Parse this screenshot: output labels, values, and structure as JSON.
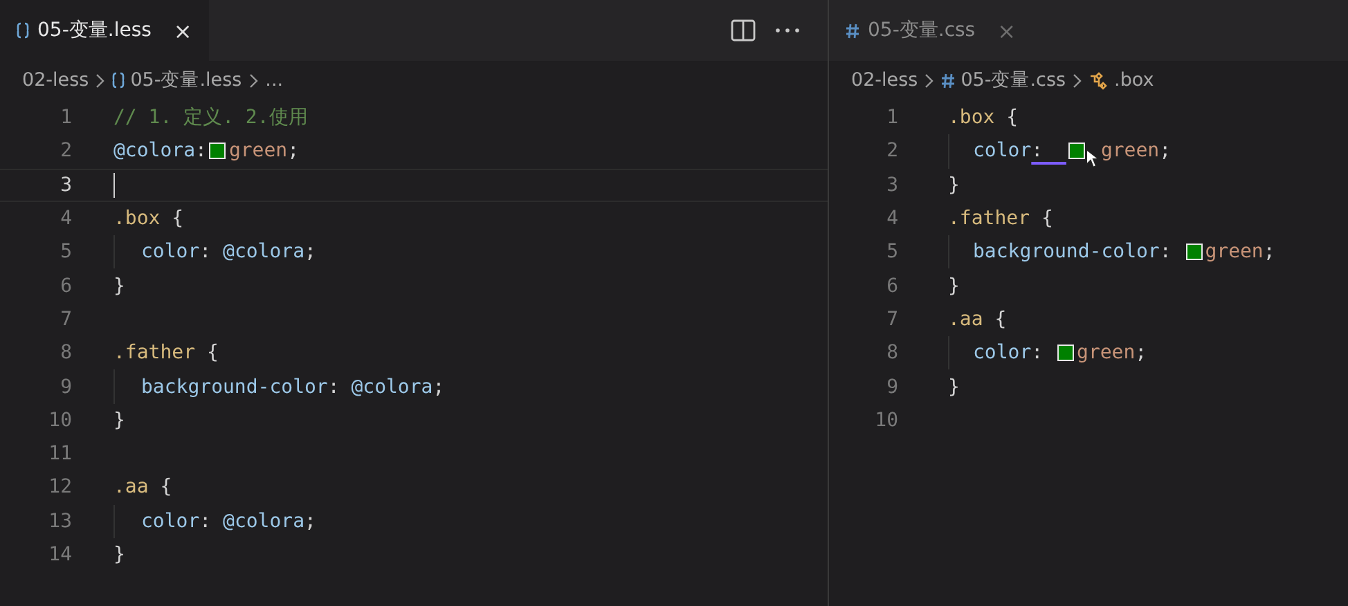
{
  "panes": [
    {
      "kind": "less",
      "tab": {
        "label": "05-变量.less",
        "selected": true,
        "close": "×"
      },
      "actions": [
        {
          "kind": "split"
        },
        {
          "kind": "more"
        }
      ],
      "breadcrumbs": [
        {
          "kind": "folder",
          "text": "02-less"
        },
        {
          "kind": "file",
          "text": "05-变量.less"
        },
        {
          "kind": "folder",
          "text": "..."
        }
      ],
      "lines": [
        {
          "number": "1",
          "current": false,
          "tokens": [
            {
              "kind": "comment",
              "text": "// 1. 定义. 2.使用"
            }
          ]
        },
        {
          "number": "2",
          "current": false,
          "tokens": [
            {
              "kind": "variable",
              "text": "@colora"
            },
            {
              "kind": "punct",
              "text": ":"
            },
            {
              "kind": "swatch",
              "color": "#008000"
            },
            {
              "kind": "value",
              "text": "green"
            },
            {
              "kind": "punct",
              "text": ";"
            }
          ]
        },
        {
          "number": "3",
          "current": true
        },
        {
          "number": "4",
          "current": false,
          "tokens": [
            {
              "kind": "selector",
              "text": ".box"
            },
            {
              "kind": "punct",
              "text": " {"
            }
          ],
          "children": [
            {
              "number": "5",
              "current": false,
              "tokens": [
                {
                  "kind": "property",
                  "text": "color"
                },
                {
                  "kind": "punct",
                  "text": ": "
                },
                {
                  "kind": "variable",
                  "text": "@colora"
                },
                {
                  "kind": "punct",
                  "text": ";"
                }
              ]
            }
          ]
        },
        {
          "number": "6",
          "current": false,
          "tokens": [
            {
              "kind": "punct",
              "text": "}"
            }
          ]
        },
        {
          "number": "7",
          "current": false
        },
        {
          "number": "8",
          "current": false,
          "tokens": [
            {
              "kind": "selector",
              "text": ".father"
            },
            {
              "kind": "punct",
              "text": " {"
            }
          ],
          "children": [
            {
              "number": "9",
              "current": false,
              "tokens": [
                {
                  "kind": "property",
                  "text": "background-color"
                },
                {
                  "kind": "punct",
                  "text": ": "
                },
                {
                  "kind": "variable",
                  "text": "@colora"
                },
                {
                  "kind": "punct",
                  "text": ";"
                }
              ]
            }
          ]
        },
        {
          "number": "10",
          "current": false,
          "tokens": [
            {
              "kind": "punct",
              "text": "}"
            }
          ]
        },
        {
          "number": "11",
          "current": false
        },
        {
          "number": "12",
          "current": false,
          "tokens": [
            {
              "kind": "selector",
              "text": ".aa"
            },
            {
              "kind": "punct",
              "text": " {"
            }
          ],
          "children": [
            {
              "number": "13",
              "current": false,
              "tokens": [
                {
                  "kind": "property",
                  "text": "color"
                },
                {
                  "kind": "punct",
                  "text": ": "
                },
                {
                  "kind": "variable",
                  "text": "@colora"
                },
                {
                  "kind": "punct",
                  "text": ";"
                }
              ]
            }
          ]
        },
        {
          "number": "14",
          "current": false,
          "tokens": [
            {
              "kind": "punct",
              "text": "}"
            }
          ]
        }
      ]
    },
    {
      "kind": "css",
      "tab": {
        "label": "05-变量.css",
        "selected": false,
        "close": "×"
      },
      "breadcrumbs": [
        {
          "kind": "folder",
          "text": "02-less"
        },
        {
          "kind": "file",
          "text": "05-变量.css"
        },
        {
          "kind": "symbol",
          "text": ".box"
        }
      ],
      "lines": [
        {
          "number": "1",
          "current": false,
          "tokens": [
            {
              "kind": "selector",
              "text": ".box"
            },
            {
              "kind": "punct",
              "text": " {"
            }
          ],
          "children": [
            {
              "number": "2",
              "current": false,
              "tokens": [
                {
                  "kind": "property",
                  "text": "color"
                },
                {
                  "kind": "punct",
                  "text": ":  ",
                  "underlined": true
                },
                {
                  "kind": "swatch",
                  "color": "#008000"
                },
                {
                  "kind": "pointer"
                },
                {
                  "kind": "value",
                  "text": "green"
                },
                {
                  "kind": "punct",
                  "text": ";"
                }
              ]
            }
          ]
        },
        {
          "number": "3",
          "current": false,
          "tokens": [
            {
              "kind": "punct",
              "text": "}"
            }
          ]
        },
        {
          "number": "4",
          "current": false,
          "tokens": [
            {
              "kind": "selector",
              "text": ".father"
            },
            {
              "kind": "punct",
              "text": " {"
            }
          ],
          "children": [
            {
              "number": "5",
              "current": false,
              "tokens": [
                {
                  "kind": "property",
                  "text": "background-color"
                },
                {
                  "kind": "punct",
                  "text": ": "
                },
                {
                  "kind": "swatch",
                  "color": "#008000"
                },
                {
                  "kind": "value",
                  "text": "green"
                },
                {
                  "kind": "punct",
                  "text": ";"
                }
              ]
            }
          ]
        },
        {
          "number": "6",
          "current": false,
          "tokens": [
            {
              "kind": "punct",
              "text": "}"
            }
          ]
        },
        {
          "number": "7",
          "current": false,
          "tokens": [
            {
              "kind": "selector",
              "text": ".aa"
            },
            {
              "kind": "punct",
              "text": " {"
            }
          ],
          "children": [
            {
              "number": "8",
              "current": false,
              "tokens": [
                {
                  "kind": "property",
                  "text": "color"
                },
                {
                  "kind": "punct",
                  "text": ": "
                },
                {
                  "kind": "swatch",
                  "color": "#008000"
                },
                {
                  "kind": "value",
                  "text": "green"
                },
                {
                  "kind": "punct",
                  "text": ";"
                }
              ]
            }
          ]
        },
        {
          "number": "9",
          "current": false,
          "tokens": [
            {
              "kind": "punct",
              "text": "}"
            }
          ]
        },
        {
          "number": "10",
          "current": false
        }
      ]
    }
  ]
}
